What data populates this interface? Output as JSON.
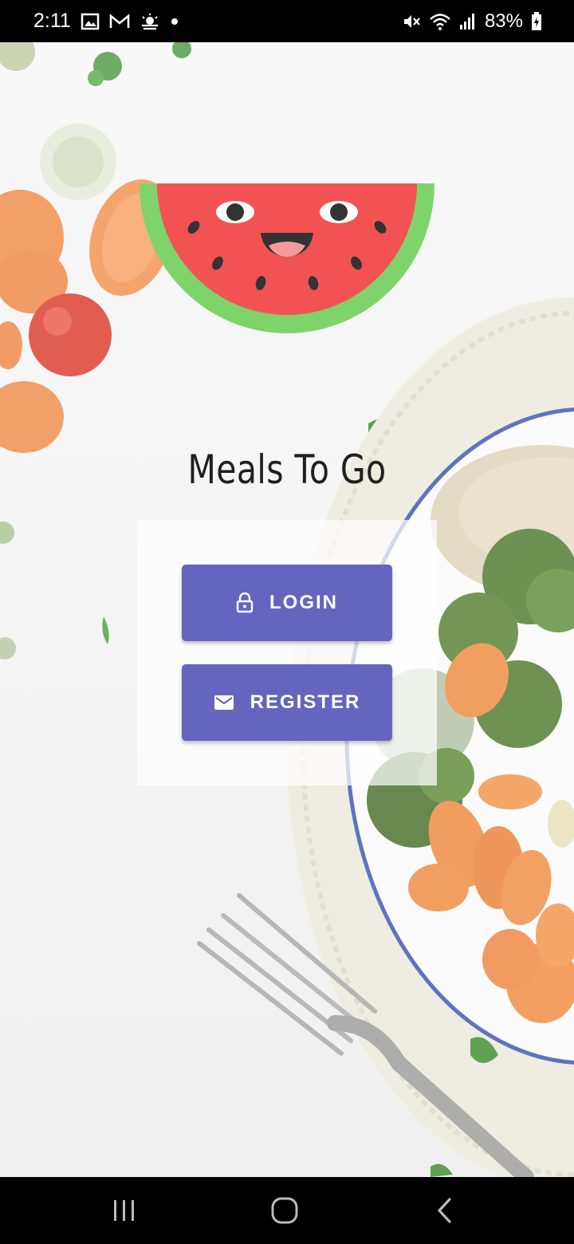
{
  "status_bar": {
    "time": "2:11",
    "battery": "83%",
    "left_icons": [
      "image-icon",
      "gmail-icon",
      "weather-icon",
      "dot-icon"
    ],
    "right_icons": [
      "mute-icon",
      "wifi-icon",
      "signal-icon",
      "battery-icon"
    ]
  },
  "app": {
    "title": "Meals To Go"
  },
  "actions": {
    "login_label": "LOGIN",
    "register_label": "REGISTER"
  },
  "nav_bar": {
    "icons": [
      "recents-icon",
      "home-icon",
      "back-icon"
    ]
  },
  "colors": {
    "button": "#6565c0",
    "watermelon_red": "#f25252",
    "watermelon_rind": "#7ed36a"
  }
}
